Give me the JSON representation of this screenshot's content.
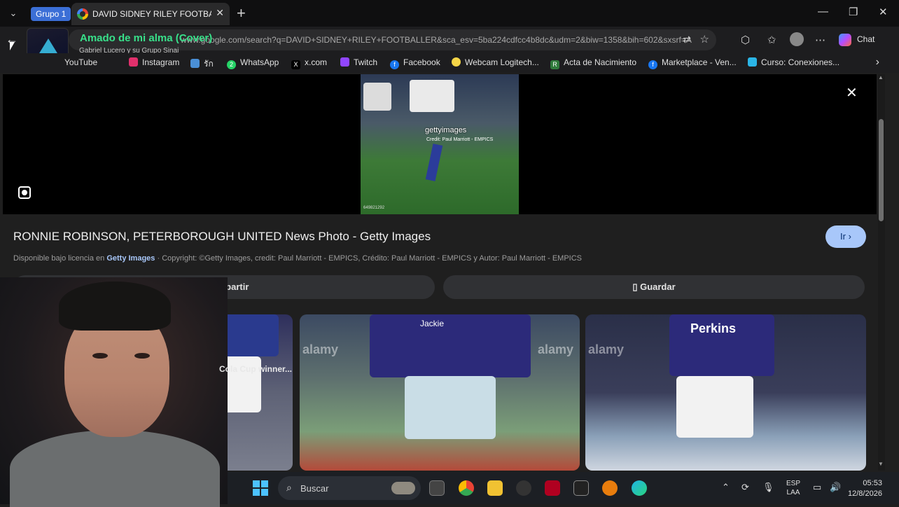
{
  "browser": {
    "group_label": "Grupo 1",
    "tab_title": "DAVID SIDNEY RILEY FOOTBALLER",
    "tab_close": "✕",
    "new_tab": "+",
    "window_controls": {
      "minimize": "—",
      "maximize": "❐",
      "close": "✕"
    },
    "url": "www.google.com/search?q=DAVID+SIDNEY+RILEY+FOOTBALLER&sca_esv=5ba224cdfcc4b8dc&udm=2&biw=1358&bih=602&sxsrf=AP...",
    "chat_label": "Chat"
  },
  "overlay": {
    "song_title": "Amado de mi alma (Cover)",
    "song_artist": "Gabriel Lucero y su Grupo Sinai"
  },
  "bookmarks": [
    {
      "label": "YouTube",
      "icon": "youtube-icon",
      "color": "#ff0000"
    },
    {
      "label": "Instagram",
      "icon": "instagram-icon",
      "color": "#e1306c"
    },
    {
      "label": "รัก",
      "icon": "thai-site-icon",
      "color": "#4a8fd6"
    },
    {
      "label": "WhatsApp",
      "icon": "whatsapp-icon",
      "color": "#25d366"
    },
    {
      "label": "x.com",
      "icon": "x-icon",
      "color": "#000000"
    },
    {
      "label": "Twitch",
      "icon": "twitch-icon",
      "color": "#9146ff"
    },
    {
      "label": "Facebook",
      "icon": "facebook-icon",
      "color": "#1877f2"
    },
    {
      "label": "Webcam Logitech...",
      "icon": "logitech-icon",
      "color": "#f5d547"
    },
    {
      "label": "Acta de Nacimiento",
      "icon": "rn-icon",
      "color": "#2f7a3b"
    },
    {
      "label": "Marketplace - Ven...",
      "icon": "facebook-icon",
      "color": "#1877f2"
    },
    {
      "label": "Curso: Conexiones...",
      "icon": "course-icon",
      "color": "#2bb5e6"
    }
  ],
  "viewer": {
    "result_title": "RONNIE ROBINSON, PETERBOROUGH UNITED News Photo - Getty Images",
    "go_button": "Ir",
    "license_prefix": "Disponible bajo licencia en",
    "license_source": "Getty Images",
    "license_rest": "· Copyright: ©Getty Images, credit: Paul Marriott - EMPICS, Crédito: Paul Marriott - EMPICS y Autor: Paul Marriott - EMPICS",
    "share_button": "Compartir",
    "save_button": "Guardar",
    "image_watermark": "gettyimages",
    "image_credit": "Credit: Paul Marriott - EMPICS",
    "image_code": "649821292"
  },
  "related": {
    "caption_1": "Cola Cup winner...",
    "watermark": "alamy",
    "shirt_text_2": "Jackie",
    "shirt_text_3": "Perkins"
  },
  "taskbar": {
    "search_placeholder": "Buscar",
    "lang_top": "ESP",
    "lang_bottom": "LAA",
    "time": "05:53",
    "date": "12/8/2026"
  }
}
